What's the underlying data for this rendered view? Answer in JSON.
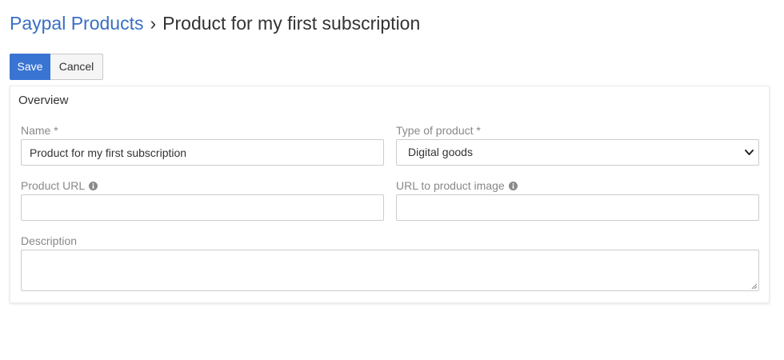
{
  "breadcrumb": {
    "parent": "Paypal Products",
    "separator": "›",
    "current": "Product for my first subscription"
  },
  "toolbar": {
    "save_label": "Save",
    "cancel_label": "Cancel"
  },
  "overview": {
    "title": "Overview",
    "name": {
      "label": "Name *",
      "value": "Product for my first subscription"
    },
    "type": {
      "label": "Type of product *",
      "selected": "Digital goods"
    },
    "product_url": {
      "label": "Product URL",
      "value": ""
    },
    "image_url": {
      "label": "URL to product image",
      "value": ""
    },
    "description": {
      "label": "Description",
      "value": ""
    }
  },
  "colors": {
    "primary": "#3a74d3",
    "link": "#3a6fc4",
    "label": "#888888"
  },
  "icons": [
    "info-icon",
    "chevron-down-icon",
    "resize-handle-icon"
  ]
}
